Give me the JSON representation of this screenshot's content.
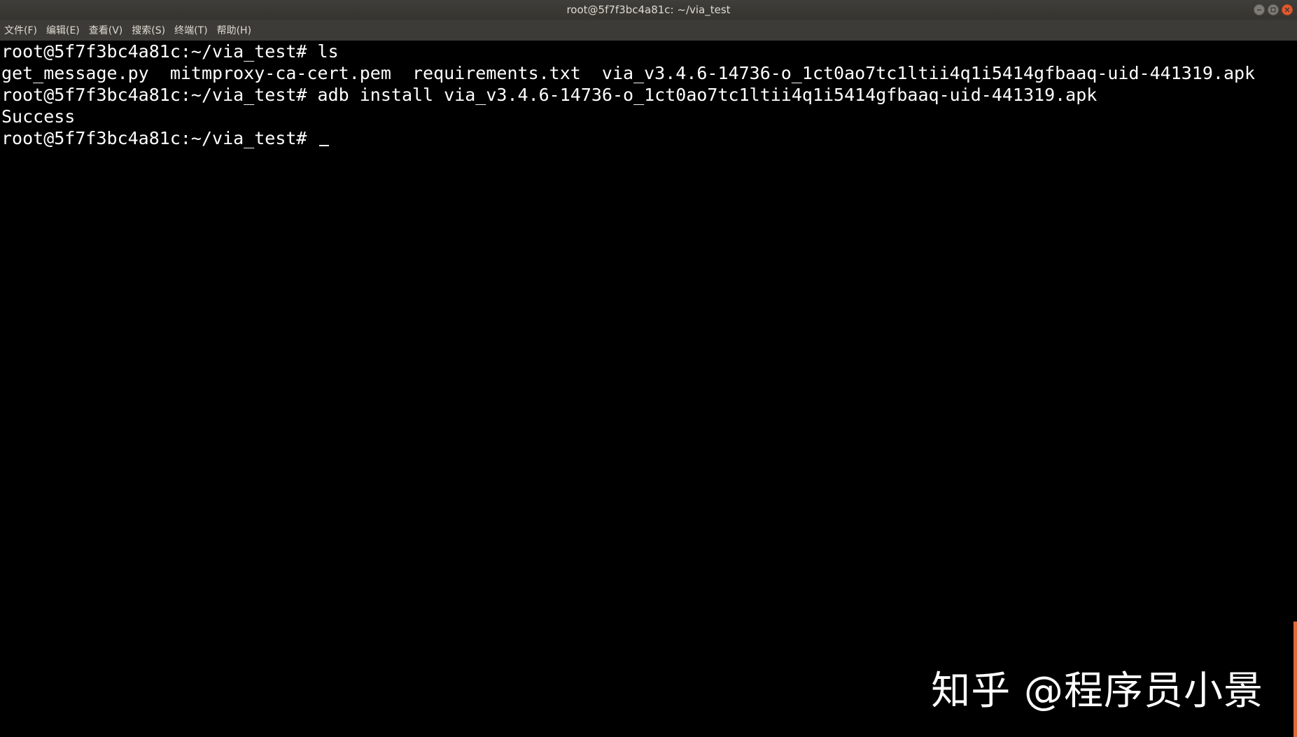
{
  "window": {
    "title": "root@5f7f3bc4a81c: ~/via_test"
  },
  "menubar": {
    "items": [
      {
        "label": "文件(F)"
      },
      {
        "label": "编辑(E)"
      },
      {
        "label": "查看(V)"
      },
      {
        "label": "搜索(S)"
      },
      {
        "label": "终端(T)"
      },
      {
        "label": "帮助(H)"
      }
    ]
  },
  "terminal": {
    "lines": [
      "root@5f7f3bc4a81c:~/via_test# ls",
      "get_message.py  mitmproxy-ca-cert.pem  requirements.txt  via_v3.4.6-14736-o_1ct0ao7tc1ltii4q1i5414gfbaaq-uid-441319.apk",
      "root@5f7f3bc4a81c:~/via_test# adb install via_v3.4.6-14736-o_1ct0ao7tc1ltii4q1i5414gfbaaq-uid-441319.apk",
      "Success",
      "root@5f7f3bc4a81c:~/via_test# "
    ]
  },
  "watermark": {
    "text": "知乎 @程序员小景"
  },
  "icons": {
    "minimize": "minimize-icon",
    "maximize": "maximize-icon",
    "close": "close-icon"
  },
  "colors": {
    "terminal_bg": "#000000",
    "terminal_fg": "#ffffff",
    "titlebar_bg": "#3c3b37",
    "close_button": "#e3592f",
    "scrollbar": "#e06a3a"
  }
}
